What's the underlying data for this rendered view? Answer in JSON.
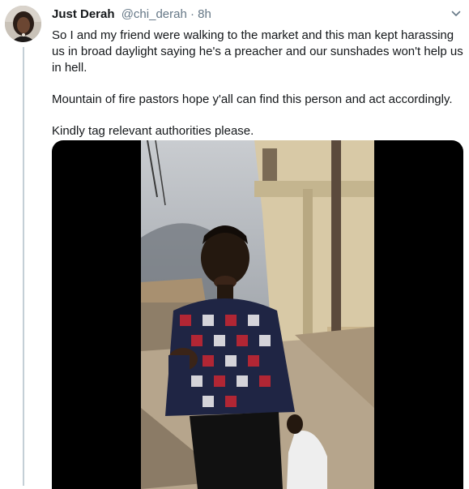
{
  "tweet": {
    "author_name": "Just Derah",
    "handle": "@chi_derah",
    "separator": "·",
    "time": "8h",
    "paragraphs": [
      "So I and my friend were walking to the market and this man kept harassing us in broad daylight saying he's a preacher and our sunshades won't help us in hell.",
      "Mountain of fire pastors hope y'all can find this person and act accordingly.",
      "Kindly tag relevant authorities please."
    ]
  },
  "icons": {
    "more": "chevron-down-icon"
  },
  "colors": {
    "text": "#14171a",
    "muted": "#657786",
    "thread_line": "#c4cfd6",
    "media_bg": "#000000"
  }
}
